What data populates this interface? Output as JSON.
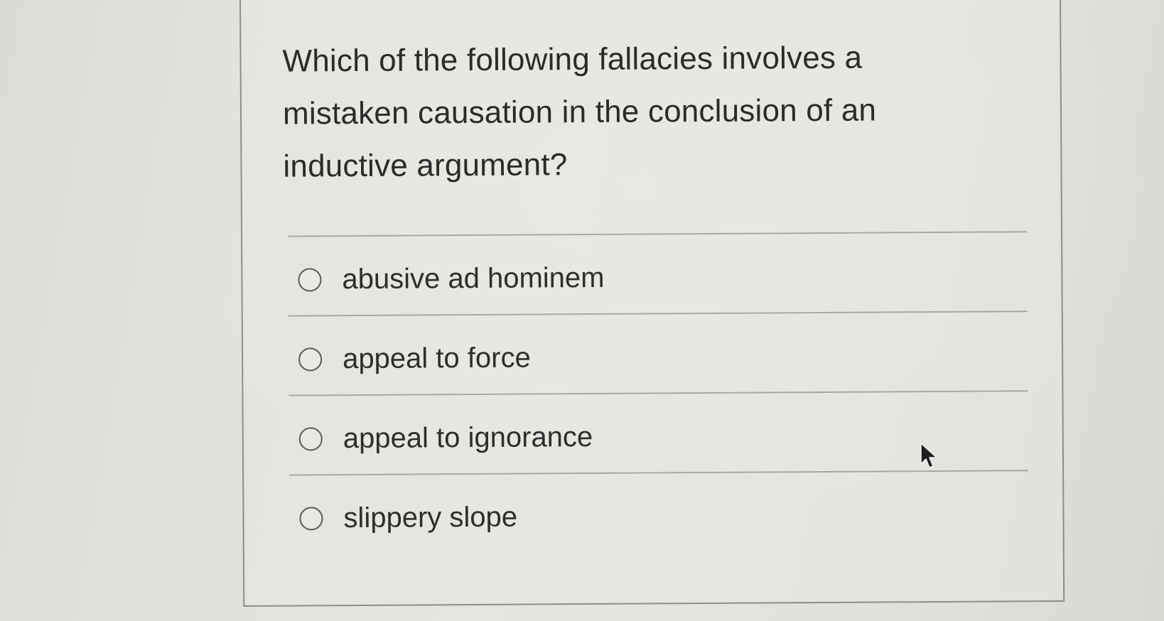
{
  "question": {
    "text": "Which of the following fallacies involves a mistaken causation in the conclusion of an inductive argument?"
  },
  "options": [
    {
      "label": "abusive ad hominem",
      "selected": false
    },
    {
      "label": "appeal to force",
      "selected": false
    },
    {
      "label": "appeal to ignorance",
      "selected": false
    },
    {
      "label": "slippery slope",
      "selected": false
    }
  ],
  "icons": {
    "radio": "radio-button-icon",
    "cursor": "mouse-pointer-icon"
  },
  "colors": {
    "background": "#e3e2dd",
    "border": "#8e8d89",
    "text": "#2b2b2b",
    "radio": "#5a5a5a"
  }
}
